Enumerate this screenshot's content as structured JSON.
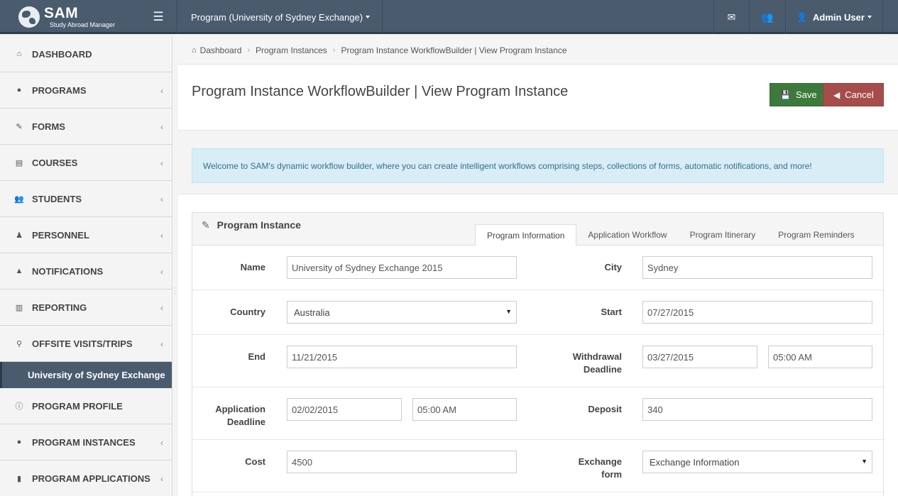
{
  "topbar": {
    "brand_title": "SAM",
    "brand_subtitle": "Study Abroad Manager",
    "program_selector": "Program (University of Sydney Exchange)",
    "user_name": "Admin User"
  },
  "sidebar": {
    "items": [
      {
        "label": "DASHBOARD",
        "icon": "home-icon"
      },
      {
        "label": "PROGRAMS",
        "icon": "globe-icon"
      },
      {
        "label": "FORMS",
        "icon": "edit-icon"
      },
      {
        "label": "COURSES",
        "icon": "book-icon"
      },
      {
        "label": "STUDENTS",
        "icon": "users-icon"
      },
      {
        "label": "PERSONNEL",
        "icon": "user-tie-icon"
      },
      {
        "label": "NOTIFICATIONS",
        "icon": "warning-icon"
      },
      {
        "label": "REPORTING",
        "icon": "bar-chart-icon"
      },
      {
        "label": "OFFSITE VISITS/TRIPS",
        "icon": "map-marker-icon"
      }
    ],
    "active_program": "University of Sydney Exchange",
    "sub_items": [
      {
        "label": "PROGRAM PROFILE",
        "icon": "info-icon"
      },
      {
        "label": "PROGRAM INSTANCES",
        "icon": "globe-icon"
      },
      {
        "label": "PROGRAM APPLICATIONS",
        "icon": "file-icon"
      }
    ]
  },
  "breadcrumb": {
    "home": "Dashboard",
    "level2": "Program Instances",
    "current": "Program Instance WorkflowBuilder | View Program Instance"
  },
  "page": {
    "title": "Program Instance WorkflowBuilder | View Program Instance",
    "save_label": "Save",
    "cancel_label": "Cancel",
    "alert": "Welcome to SAM's dynamic workflow builder, where you can create intelligent workflows comprising steps, collections of forms, automatic notifications, and more!"
  },
  "panel": {
    "title": "Program Instance",
    "tabs": [
      "Program Information",
      "Application Workflow",
      "Program Itinerary",
      "Program Reminders"
    ],
    "fields": {
      "name_label": "Name",
      "name_value": "University of Sydney Exchange 2015",
      "city_label": "City",
      "city_value": "Sydney",
      "country_label": "Country",
      "country_value": "Australia",
      "start_label": "Start",
      "start_value": "07/27/2015",
      "end_label": "End",
      "end_value": "11/21/2015",
      "withdrawal_label_1": "Withdrawal",
      "withdrawal_label_2": "Deadline",
      "withdrawal_date": "03/27/2015",
      "withdrawal_time": "05:00 AM",
      "app_deadline_label_1": "Application",
      "app_deadline_label_2": "Deadline",
      "app_deadline_date": "02/02/2015",
      "app_deadline_time": "05:00 AM",
      "deposit_label": "Deposit",
      "deposit_value": "340",
      "cost_label": "Cost",
      "cost_value": "4500",
      "exchange_label_1": "Exchange",
      "exchange_label_2": "form",
      "exchange_value": "Exchange Information"
    }
  }
}
